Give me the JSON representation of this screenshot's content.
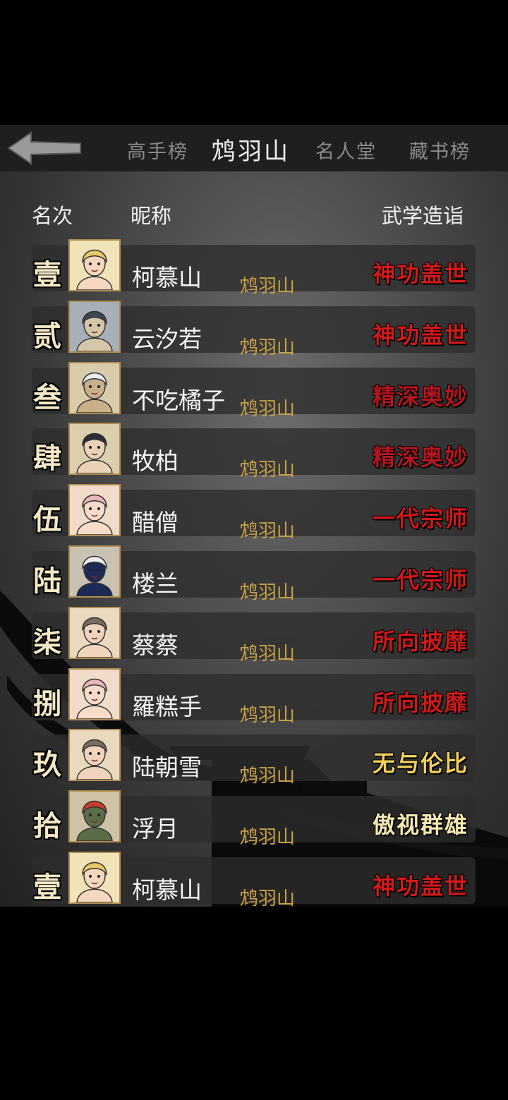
{
  "header": {
    "tabs": [
      {
        "label": "高手榜",
        "active": false
      },
      {
        "label": "鸩羽山",
        "active": true
      },
      {
        "label": "名人堂",
        "active": false
      },
      {
        "label": "藏书榜",
        "active": false
      }
    ]
  },
  "columns": {
    "rank": "名次",
    "nickname": "昵称",
    "skill": "武学造诣"
  },
  "rows": [
    {
      "rank": "壹",
      "name": "柯慕山",
      "sect": "鸩羽山",
      "level": "神功盖世",
      "level_color": "#d11a1a",
      "avatar": "girl-blonde-avatar"
    },
    {
      "rank": "贰",
      "name": "云汐若",
      "sect": "鸩羽山",
      "level": "神功盖世",
      "level_color": "#d11a1a",
      "avatar": "swordsman-ink-avatar"
    },
    {
      "rank": "叁",
      "name": "不吃橘子",
      "sect": "鸩羽山",
      "level": "精深奥妙",
      "level_color": "#b3161e",
      "avatar": "old-master-avatar"
    },
    {
      "rank": "肆",
      "name": "牧柏",
      "sect": "鸩羽山",
      "level": "精深奥妙",
      "level_color": "#b3161e",
      "avatar": "young-hero-avatar"
    },
    {
      "rank": "伍",
      "name": "醋僧",
      "sect": "鸩羽山",
      "level": "一代宗师",
      "level_color": "#d01818",
      "avatar": "girl-pink-avatar"
    },
    {
      "rank": "陆",
      "name": "楼兰",
      "sect": "鸩羽山",
      "level": "一代宗师",
      "level_color": "#d01818",
      "avatar": "taoist-elder-avatar"
    },
    {
      "rank": "柒",
      "name": "蔡蔡",
      "sect": "鸩羽山",
      "level": "所向披靡",
      "level_color": "#cc1a1a",
      "avatar": "girl-smile-avatar"
    },
    {
      "rank": "捌",
      "name": "羅糕手",
      "sect": "鸩羽山",
      "level": "所向披靡",
      "level_color": "#cc1a1a",
      "avatar": "girl-pink-avatar"
    },
    {
      "rank": "玖",
      "name": "陆朝雪",
      "sect": "鸩羽山",
      "level": "无与伦比",
      "level_color": "#f2d05c",
      "avatar": "girl-smile-avatar"
    },
    {
      "rank": "拾",
      "name": "浮月",
      "sect": "鸩羽山",
      "level": "傲视群雄",
      "level_color": "#f4e7b0",
      "avatar": "monkey-king-avatar"
    },
    {
      "rank": "壹",
      "name": "柯慕山",
      "sect": "鸩羽山",
      "level": "神功盖世",
      "level_color": "#d11a1a",
      "avatar": "girl-blonde-avatar"
    }
  ]
}
